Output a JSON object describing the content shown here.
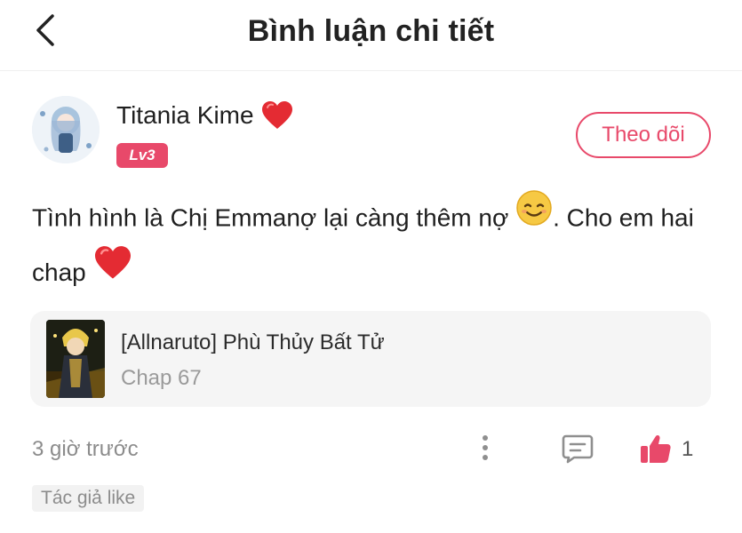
{
  "header": {
    "title": "Bình luận chi tiết",
    "back_icon": "chevron-left-icon"
  },
  "user": {
    "name": "Titania Kime",
    "name_icon": "heart-icon",
    "level": "Lv3",
    "follow_label": "Theo dõi"
  },
  "comment": {
    "text_part1": "Tình hình là Chị Emmanợ lại càng thêm nợ",
    "text_part2": ". Cho em hai chap",
    "emoji_1": "smiling-face-icon",
    "emoji_2": "heart-icon"
  },
  "reference": {
    "title": "[Allnaruto] Phù Thủy Bất Tử",
    "chapter": "Chap 67"
  },
  "footer": {
    "time": "3 giờ trước",
    "like_count": "1",
    "author_like_badge": "Tác giả like"
  },
  "colors": {
    "accent": "#e8496a",
    "muted": "#8c8c8c",
    "card_bg": "#f5f5f5"
  }
}
